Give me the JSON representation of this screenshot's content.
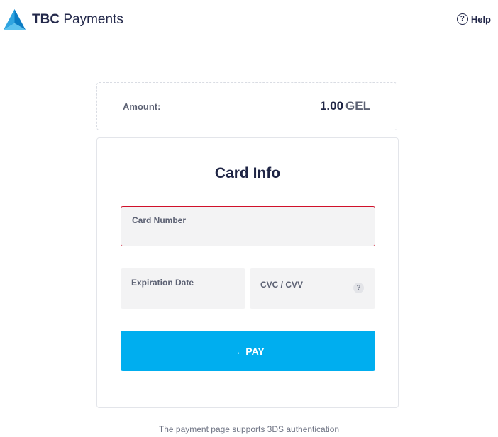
{
  "header": {
    "brand_bold": "TBC",
    "brand_rest": "Payments",
    "help_icon_glyph": "?",
    "help_label": "Help",
    "brand_color": "#00aeef"
  },
  "amount": {
    "label": "Amount:",
    "value": "1.00",
    "currency": "GEL"
  },
  "card_form": {
    "title": "Card Info",
    "card_number_label": "Card Number",
    "expiration_label": "Expiration Date",
    "cvc_label": "CVC / CVV",
    "cvc_help_glyph": "?",
    "card_number_value": "",
    "expiration_value": "",
    "cvc_value": "",
    "error_border_color": "#d0102a"
  },
  "pay_button": {
    "arrow_glyph": "→",
    "label": "PAY",
    "color": "#00aeef"
  },
  "footer": {
    "note": "The payment page supports 3DS authentication"
  }
}
